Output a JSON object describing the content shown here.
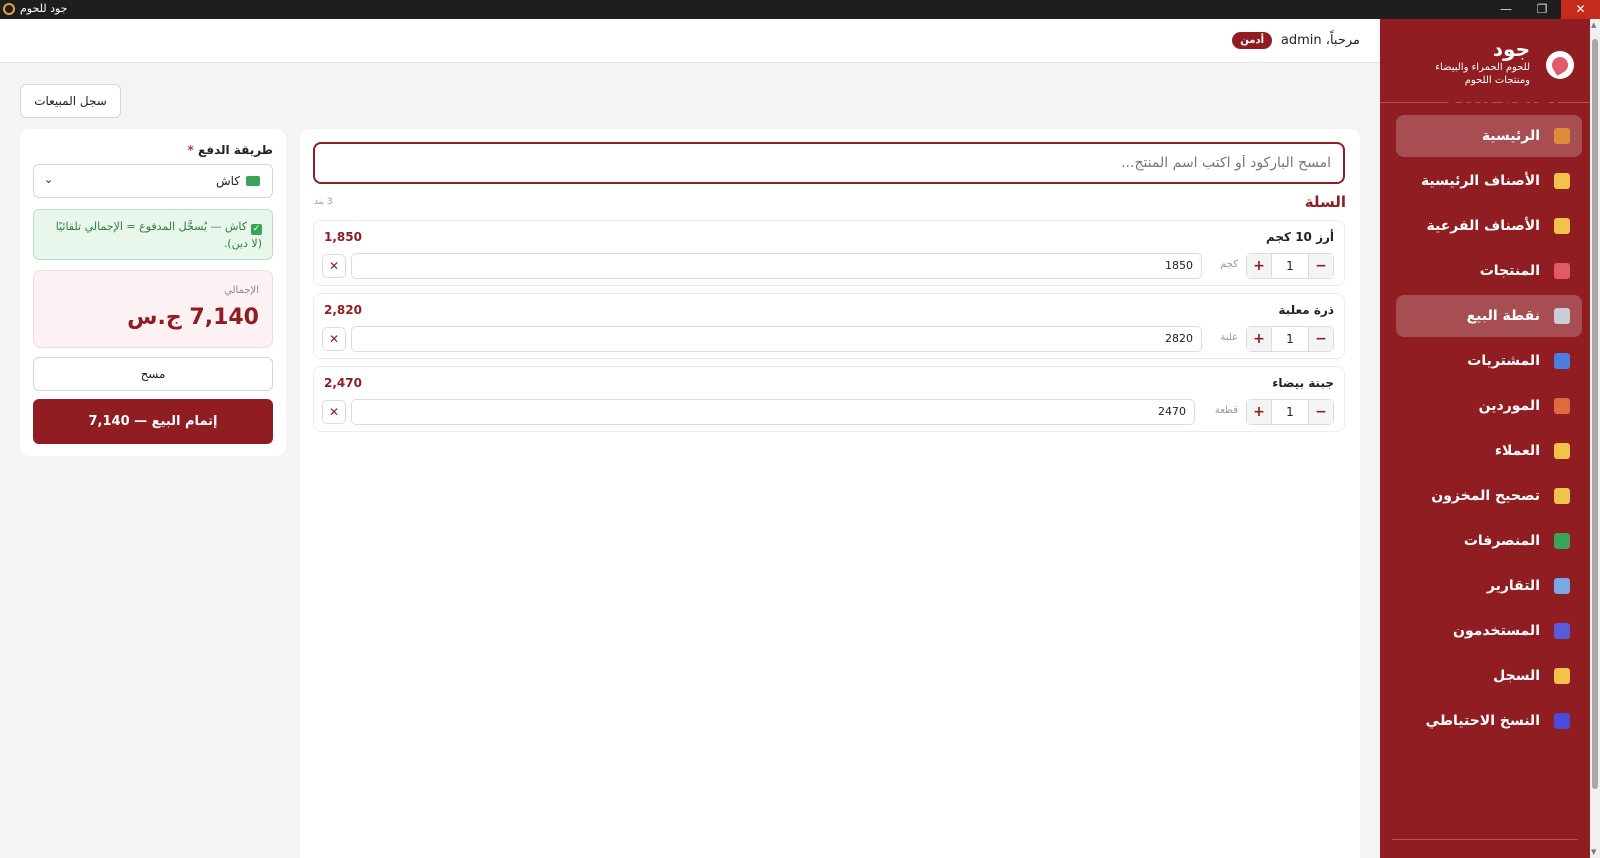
{
  "window": {
    "title": "جود للحوم",
    "minimize": "—",
    "maximize": "❐",
    "close": "✕"
  },
  "brand": {
    "name": "جود",
    "tagline": "للحوم الحمراء والبيضاء ومنتجات اللحوم"
  },
  "sidebar": {
    "items": [
      {
        "label": "الرئيسية",
        "icon": "home-icon",
        "color": "#e08a3c"
      },
      {
        "label": "الأصناف الرئيسية",
        "icon": "folder-icon",
        "color": "#f3c24b"
      },
      {
        "label": "الأصناف الفرعية",
        "icon": "folder-icon",
        "color": "#f3c24b"
      },
      {
        "label": "المنتجات",
        "icon": "meat-icon",
        "color": "#e05a6a"
      },
      {
        "label": "نقطة البيع",
        "icon": "register-icon",
        "color": "#c9ced6"
      },
      {
        "label": "المشتريات",
        "icon": "shopping-bag-icon",
        "color": "#4a7fe0"
      },
      {
        "label": "الموردين",
        "icon": "truck-icon",
        "color": "#e06a3c"
      },
      {
        "label": "العملاء",
        "icon": "customer-icon",
        "color": "#f3c24b"
      },
      {
        "label": "تصحيح المخزون",
        "icon": "scale-icon",
        "color": "#f3c24b"
      },
      {
        "label": "المنصرفات",
        "icon": "money-wings-icon",
        "color": "#3aa35a"
      },
      {
        "label": "التقارير",
        "icon": "bar-chart-icon",
        "color": "#7aa7e8"
      },
      {
        "label": "المستخدمون",
        "icon": "users-icon",
        "color": "#5a5adc"
      },
      {
        "label": "السجل",
        "icon": "scroll-icon",
        "color": "#f3c24b"
      },
      {
        "label": "النسخ الاحتياطي",
        "icon": "floppy-disk-icon",
        "color": "#4a4adc"
      }
    ],
    "active_index": 4,
    "highlight_index": 0
  },
  "header": {
    "welcome": "مرحباً، admin",
    "role": "أدمن"
  },
  "page": {
    "title": "نقطة البيع",
    "history_button": "سجل المبيعات"
  },
  "cart": {
    "search_placeholder": "امسح الباركود أو اكتب اسم المنتج...",
    "title": "السلة",
    "count": "3 بند",
    "items": [
      {
        "name": "أرز 10 كجم",
        "total": "1,850",
        "qty": "1",
        "unit": "كجم",
        "price": "1850"
      },
      {
        "name": "ذرة معلبة",
        "total": "2,820",
        "qty": "1",
        "unit": "علبة",
        "price": "2820"
      },
      {
        "name": "جبنة بيضاء",
        "total": "2,470",
        "qty": "1",
        "unit": "قطعة",
        "price": "2470"
      }
    ],
    "minus": "−",
    "plus": "+",
    "remove": "✕"
  },
  "payment": {
    "label": "طريقة الدفع",
    "required_mark": "*",
    "method": "كاش",
    "note": "كاش — يُسجَّل المدفوع = الإجمالي تلقائيًا (لا دين).",
    "total_label": "الإجمالي",
    "total_value": "7,140 ج.س",
    "clear_button": "مسح",
    "complete_button": "إتمام البيع — 7,140"
  }
}
